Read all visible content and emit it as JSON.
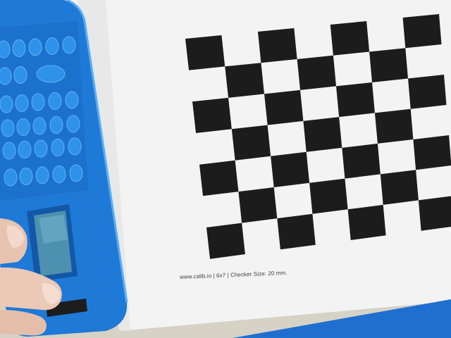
{
  "caption": "www.calib.io | 6x7 | Checker Size: 20 mm.",
  "pattern": {
    "columns": 7,
    "rows": 6
  },
  "colors": {
    "background": "#d6d2c6",
    "paper": "#f3f3f3",
    "checker": "#1c1c1c",
    "device_body": "#1f79d6",
    "device_edge": "#1559a8",
    "device_buttons": "#2e92e8",
    "device_screen": "#4d90b0",
    "skin": "#e8c3b0"
  }
}
